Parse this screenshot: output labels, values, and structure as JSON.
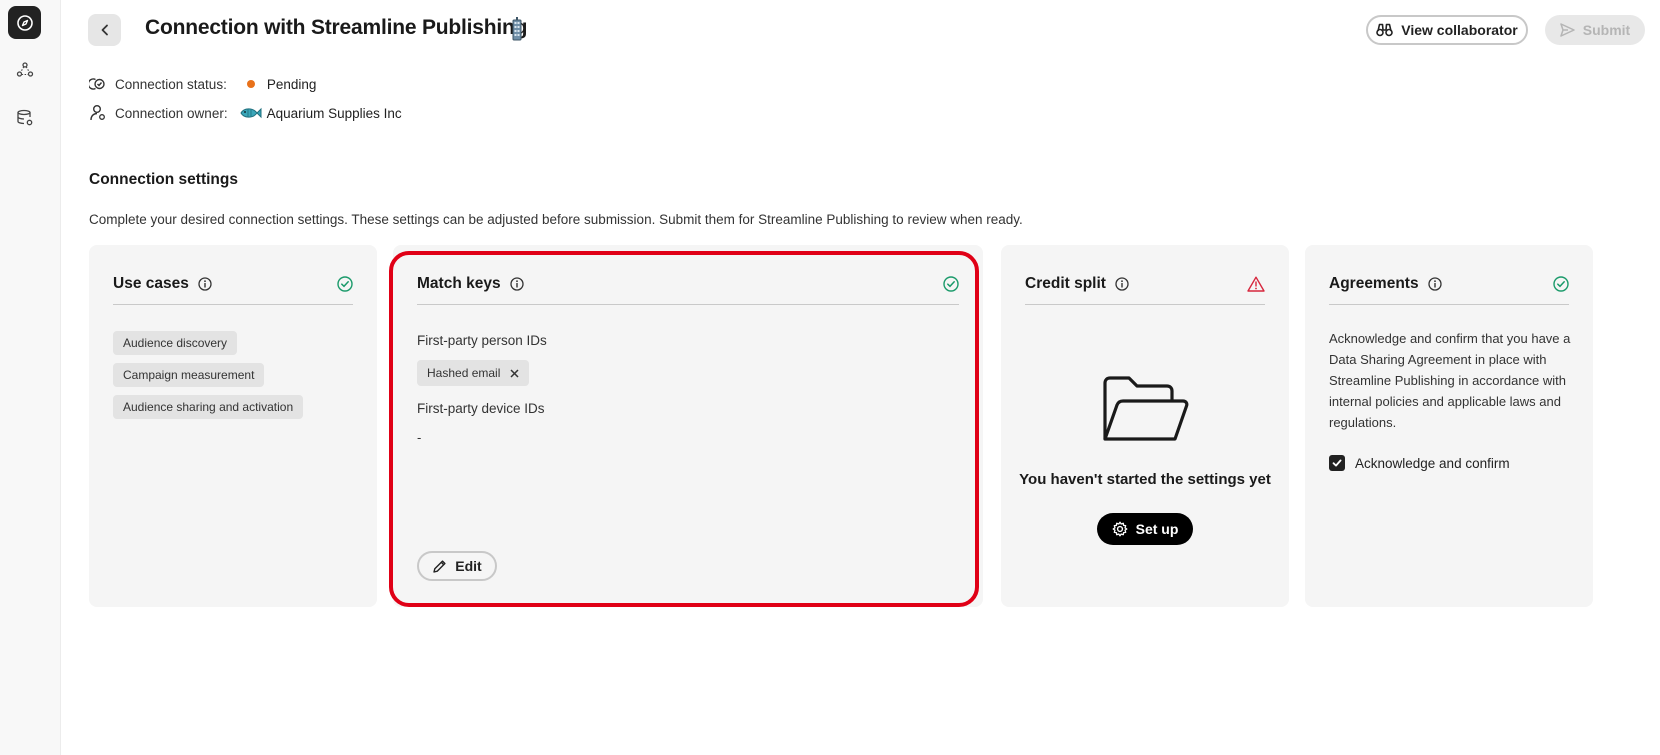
{
  "header": {
    "title": "Connection with Streamline Publishing",
    "view_collaborator_label": "View collaborator",
    "submit_label": "Submit"
  },
  "meta": {
    "status_label": "Connection status:",
    "status_value": "Pending",
    "status_color": "#e8711a",
    "owner_label": "Connection owner:",
    "owner_value": "Aquarium Supplies Inc"
  },
  "section": {
    "title": "Connection settings",
    "description": "Complete your desired connection settings. These settings can be adjusted before submission. Submit them for Streamline Publishing to review when ready."
  },
  "cards": {
    "use_cases": {
      "title": "Use cases",
      "status": "complete",
      "chips": [
        "Audience discovery",
        "Campaign measurement",
        "Audience sharing and activation"
      ]
    },
    "match_keys": {
      "title": "Match keys",
      "status": "complete",
      "person_ids_label": "First-party person IDs",
      "person_id_chip": "Hashed email",
      "device_ids_label": "First-party device IDs",
      "device_ids_value": "-",
      "edit_label": "Edit"
    },
    "credit_split": {
      "title": "Credit split",
      "status": "warning",
      "empty_text": "You haven't started the settings yet",
      "setup_label": "Set up"
    },
    "agreements": {
      "title": "Agreements",
      "status": "complete",
      "body": "Acknowledge and confirm that you have a Data Sharing Agreement in place with Streamline Publishing in accordance with internal policies and applicable laws and regulations.",
      "ack_label": "Acknowledge and confirm",
      "ack_checked": true
    }
  },
  "colors": {
    "success": "#1a9a6a",
    "warning": "#d7263d",
    "highlight": "#e00016"
  }
}
